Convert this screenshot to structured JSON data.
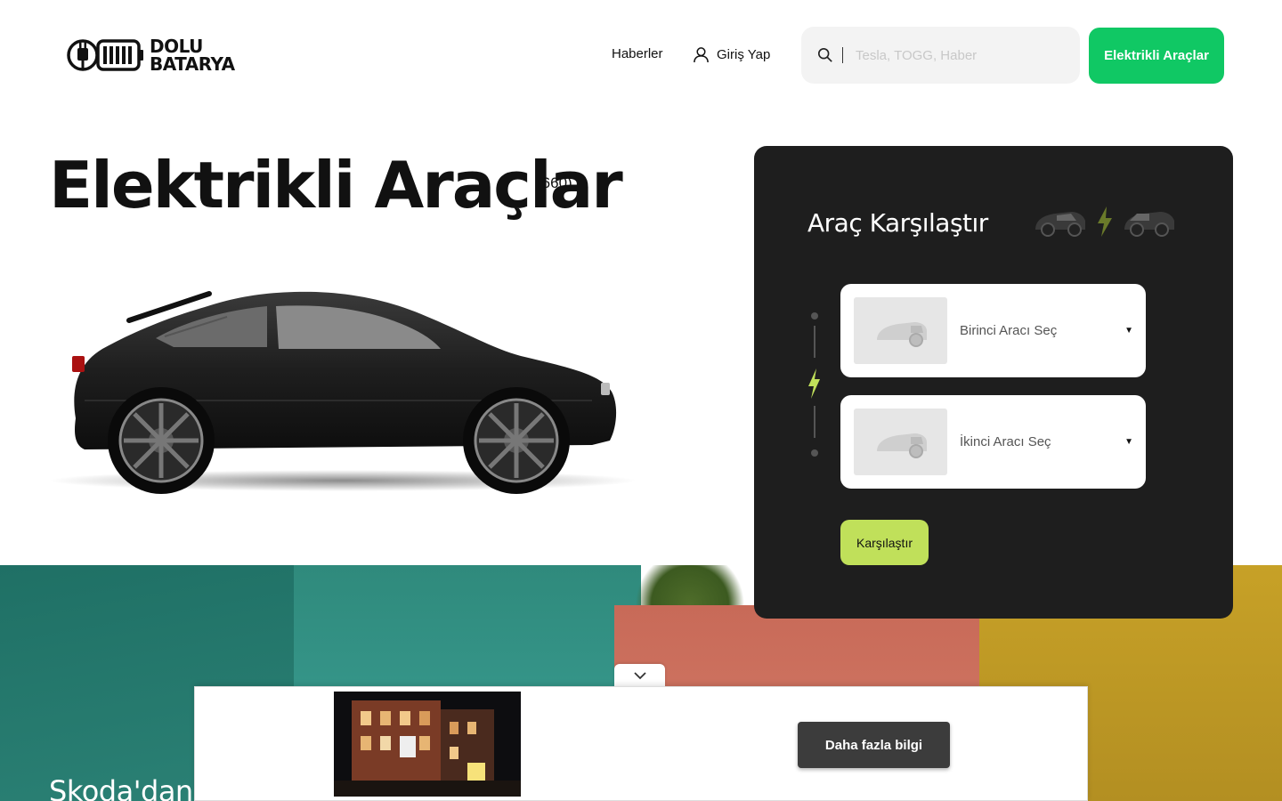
{
  "header": {
    "logo_line1": "DOLU",
    "logo_line2": "BATARYA",
    "nav_news": "Haberler",
    "nav_login": "Giriş Yap",
    "search_placeholder": "Tesla, TOGG, Haber",
    "cta_label": "Elektrikli Araçlar"
  },
  "hero": {
    "title": "Elektrikli Araçlar",
    "count": "(660)"
  },
  "compare": {
    "title": "Araç Karşılaştır",
    "first_select": "Birinci Aracı Seç",
    "second_select": "İkinci Aracı Seç",
    "button_label": "Karşılaştır"
  },
  "banner": {
    "title": "Skoda'dan"
  },
  "ad": {
    "button_label": "Daha fazla bilgi"
  },
  "colors": {
    "accent_green": "#10c864",
    "lime": "#c0e05a",
    "panel_dark": "#1e1e1e"
  }
}
